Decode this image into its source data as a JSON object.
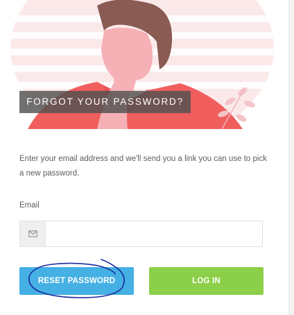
{
  "page": {
    "title": "FORGOT YOUR PASSWORD?",
    "description": "Enter your email address and we'll send you a link you can use to pick a new password.",
    "email_label": "Email",
    "email_value": "",
    "email_placeholder": "",
    "icons": {
      "email": "envelope-icon"
    }
  },
  "buttons": {
    "reset": "RESET PASSWORD",
    "login": "LOG IN"
  },
  "colors": {
    "reset_button": "#45b0e4",
    "login_button": "#8ccf48",
    "annotation": "#1b2a9e"
  }
}
